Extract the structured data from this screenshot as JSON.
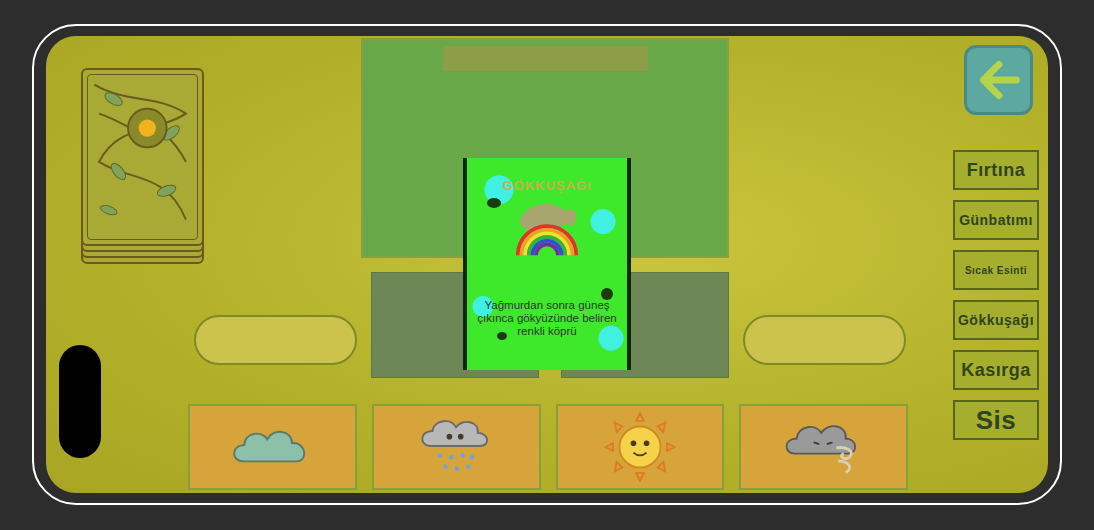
{
  "played_card": {
    "title": "GÖKKUŞAĞI",
    "description": "Yağmurdan sonra güneş çıkınca gökyüzünde beliren renkli köprü"
  },
  "hand": [
    {
      "kind": "cloud"
    },
    {
      "kind": "rain"
    },
    {
      "kind": "sun"
    },
    {
      "kind": "wind"
    }
  ],
  "answers": [
    {
      "label": "Fırtına",
      "selected": false
    },
    {
      "label": "Günbatımı",
      "selected": false
    },
    {
      "label": "Sıcak Esinti",
      "selected": false
    },
    {
      "label": "Gökkuşağı",
      "selected": false
    },
    {
      "label": "Kasırga",
      "selected": false
    },
    {
      "label": "Sis",
      "selected": false
    }
  ]
}
